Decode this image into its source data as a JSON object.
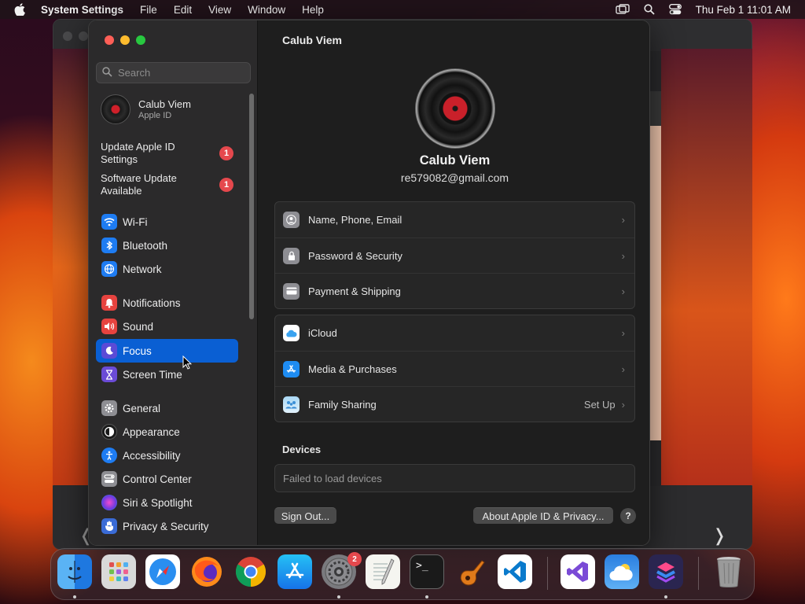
{
  "menubar": {
    "app_name": "System Settings",
    "menus": [
      "File",
      "Edit",
      "View",
      "Window",
      "Help"
    ],
    "clock": "Thu Feb 1  11:01 AM"
  },
  "sidebar": {
    "search_placeholder": "Search",
    "profile": {
      "name": "Calub Viem",
      "subtitle": "Apple ID"
    },
    "alerts": [
      {
        "label": "Update Apple ID Settings",
        "count": "1"
      },
      {
        "label": "Software Update Available",
        "count": "1"
      }
    ],
    "items": [
      {
        "label": "Wi-Fi",
        "icon": "wifi-icon",
        "color": "#1e7cf2"
      },
      {
        "label": "Bluetooth",
        "icon": "bluetooth-icon",
        "color": "#1e7cf2"
      },
      {
        "label": "Network",
        "icon": "globe-icon",
        "color": "#1e7cf2"
      },
      {
        "label": "Notifications",
        "icon": "bell-icon",
        "color": "#e6433f"
      },
      {
        "label": "Sound",
        "icon": "speaker-icon",
        "color": "#e6433f"
      },
      {
        "label": "Focus",
        "icon": "moon-icon",
        "color": "#5b4bd6",
        "selected": true
      },
      {
        "label": "Screen Time",
        "icon": "hourglass-icon",
        "color": "#6b4bd6"
      },
      {
        "label": "General",
        "icon": "gear-icon",
        "color": "#8e8e93"
      },
      {
        "label": "Appearance",
        "icon": "appearance-icon",
        "color": "#1a1a1a"
      },
      {
        "label": "Accessibility",
        "icon": "accessibility-icon",
        "color": "#1e7cf2"
      },
      {
        "label": "Control Center",
        "icon": "control-center-icon",
        "color": "#8e8e93"
      },
      {
        "label": "Siri & Spotlight",
        "icon": "siri-icon",
        "color": "#b03bd6"
      },
      {
        "label": "Privacy & Security",
        "icon": "hand-icon",
        "color": "#3a6bd6"
      }
    ]
  },
  "main": {
    "title": "Calub Viem",
    "user_name": "Calub Viem",
    "email": "re579082@gmail.com",
    "group1": [
      {
        "label": "Name, Phone, Email",
        "icon": "contact-icon"
      },
      {
        "label": "Password & Security",
        "icon": "lock-icon"
      },
      {
        "label": "Payment & Shipping",
        "icon": "card-icon"
      }
    ],
    "group2": [
      {
        "label": "iCloud",
        "icon": "icloud-icon"
      },
      {
        "label": "Media & Purchases",
        "icon": "app-store-icon"
      },
      {
        "label": "Family Sharing",
        "icon": "family-icon",
        "extra": "Set Up"
      }
    ],
    "devices_title": "Devices",
    "devices_message": "Failed to load devices",
    "sign_out": "Sign Out...",
    "about": "About Apple ID & Privacy...",
    "help": "?"
  },
  "dock": {
    "apps": [
      "Finder",
      "Launchpad",
      "Safari",
      "Firefox",
      "Chrome",
      "App Store",
      "System Settings",
      "TextEdit",
      "Terminal",
      "GarageBand",
      "VS Code",
      "Visual Studio",
      "Weather",
      "Shortcuts",
      "Trash"
    ],
    "system_settings_badge": "2"
  }
}
